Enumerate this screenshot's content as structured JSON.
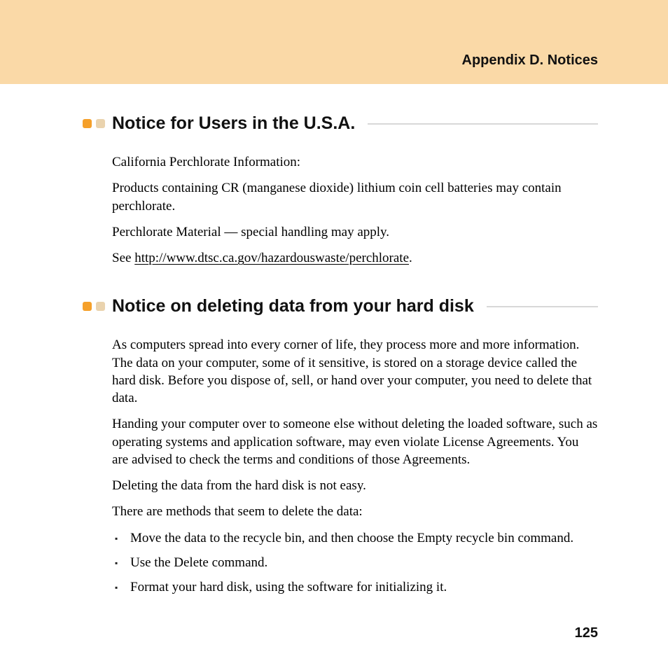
{
  "header": {
    "title": "Appendix D. Notices"
  },
  "page_number": "125",
  "sections": [
    {
      "heading": "Notice for Users in the U.S.A.",
      "paragraphs": [
        "California Perchlorate Information:",
        "Products containing CR (manganese dioxide) lithium coin cell batteries may contain perchlorate.",
        "Perchlorate Material — special handling may apply."
      ],
      "see_prefix": "See ",
      "see_link": "http://www.dtsc.ca.gov/hazardouswaste/perchlorate",
      "see_suffix": "."
    },
    {
      "heading": "Notice on deleting data from your hard disk",
      "paragraphs": [
        "As computers spread into every corner of life, they process more and more information. The data on your computer, some of it sensitive, is stored on a storage device called the hard disk. Before you dispose of, sell, or hand over your computer, you need to delete that data.",
        "Handing your computer over to someone else without deleting the loaded software, such as operating systems and application software, may even violate License Agreements. You are advised to check the terms and conditions of those Agreements.",
        "Deleting the data from the hard disk is not easy.",
        "There are methods that seem to delete the data:"
      ],
      "bullets": [
        "Move the data to the recycle bin, and then choose the Empty recycle bin command.",
        "Use the Delete command.",
        "Format your hard disk, using the software for initializing it."
      ]
    }
  ]
}
